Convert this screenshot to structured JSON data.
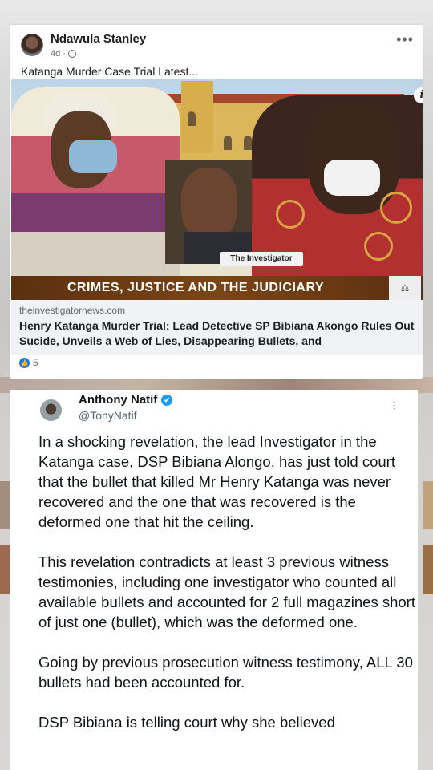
{
  "facebook_post": {
    "author": "Ndawula Stanley",
    "time": "4d",
    "menu_icon": "more-horizontal-icon",
    "text": "Katanga Murder Case Trial Latest...",
    "image": {
      "brand": "The Investigator",
      "banner": "CRIMES, JUSTICE AND THE JUDICIARY",
      "info_icon": "i"
    },
    "link": {
      "domain": "theinvestigatornews.com",
      "title": "Henry Katanga Murder Trial: Lead Detective SP Bibiana Akongo Rules Out Sucide, Unveils a Web of Lies, Disappearing Bullets, and"
    },
    "reactions": {
      "count": "5"
    }
  },
  "tweet": {
    "name": "Anthony Natif",
    "handle": "@TonyNatif",
    "paragraphs": [
      "In a shocking revelation, the lead Investigator in the Katanga case, DSP Bibiana Alongo, has just told court that the bullet that killed Mr Henry Katanga was never recovered and the one that was recovered is the deformed one that hit the ceiling.",
      "This revelation contradicts at least 3 previous witness testimonies, including one investigator who counted all available bullets and accounted for 2 full magazines short of just one (bullet), which was the deformed one.",
      "Going by previous prosecution witness testimony, ALL 30 bullets had been accounted for.",
      "DSP Bibiana is telling court why she believed"
    ]
  }
}
